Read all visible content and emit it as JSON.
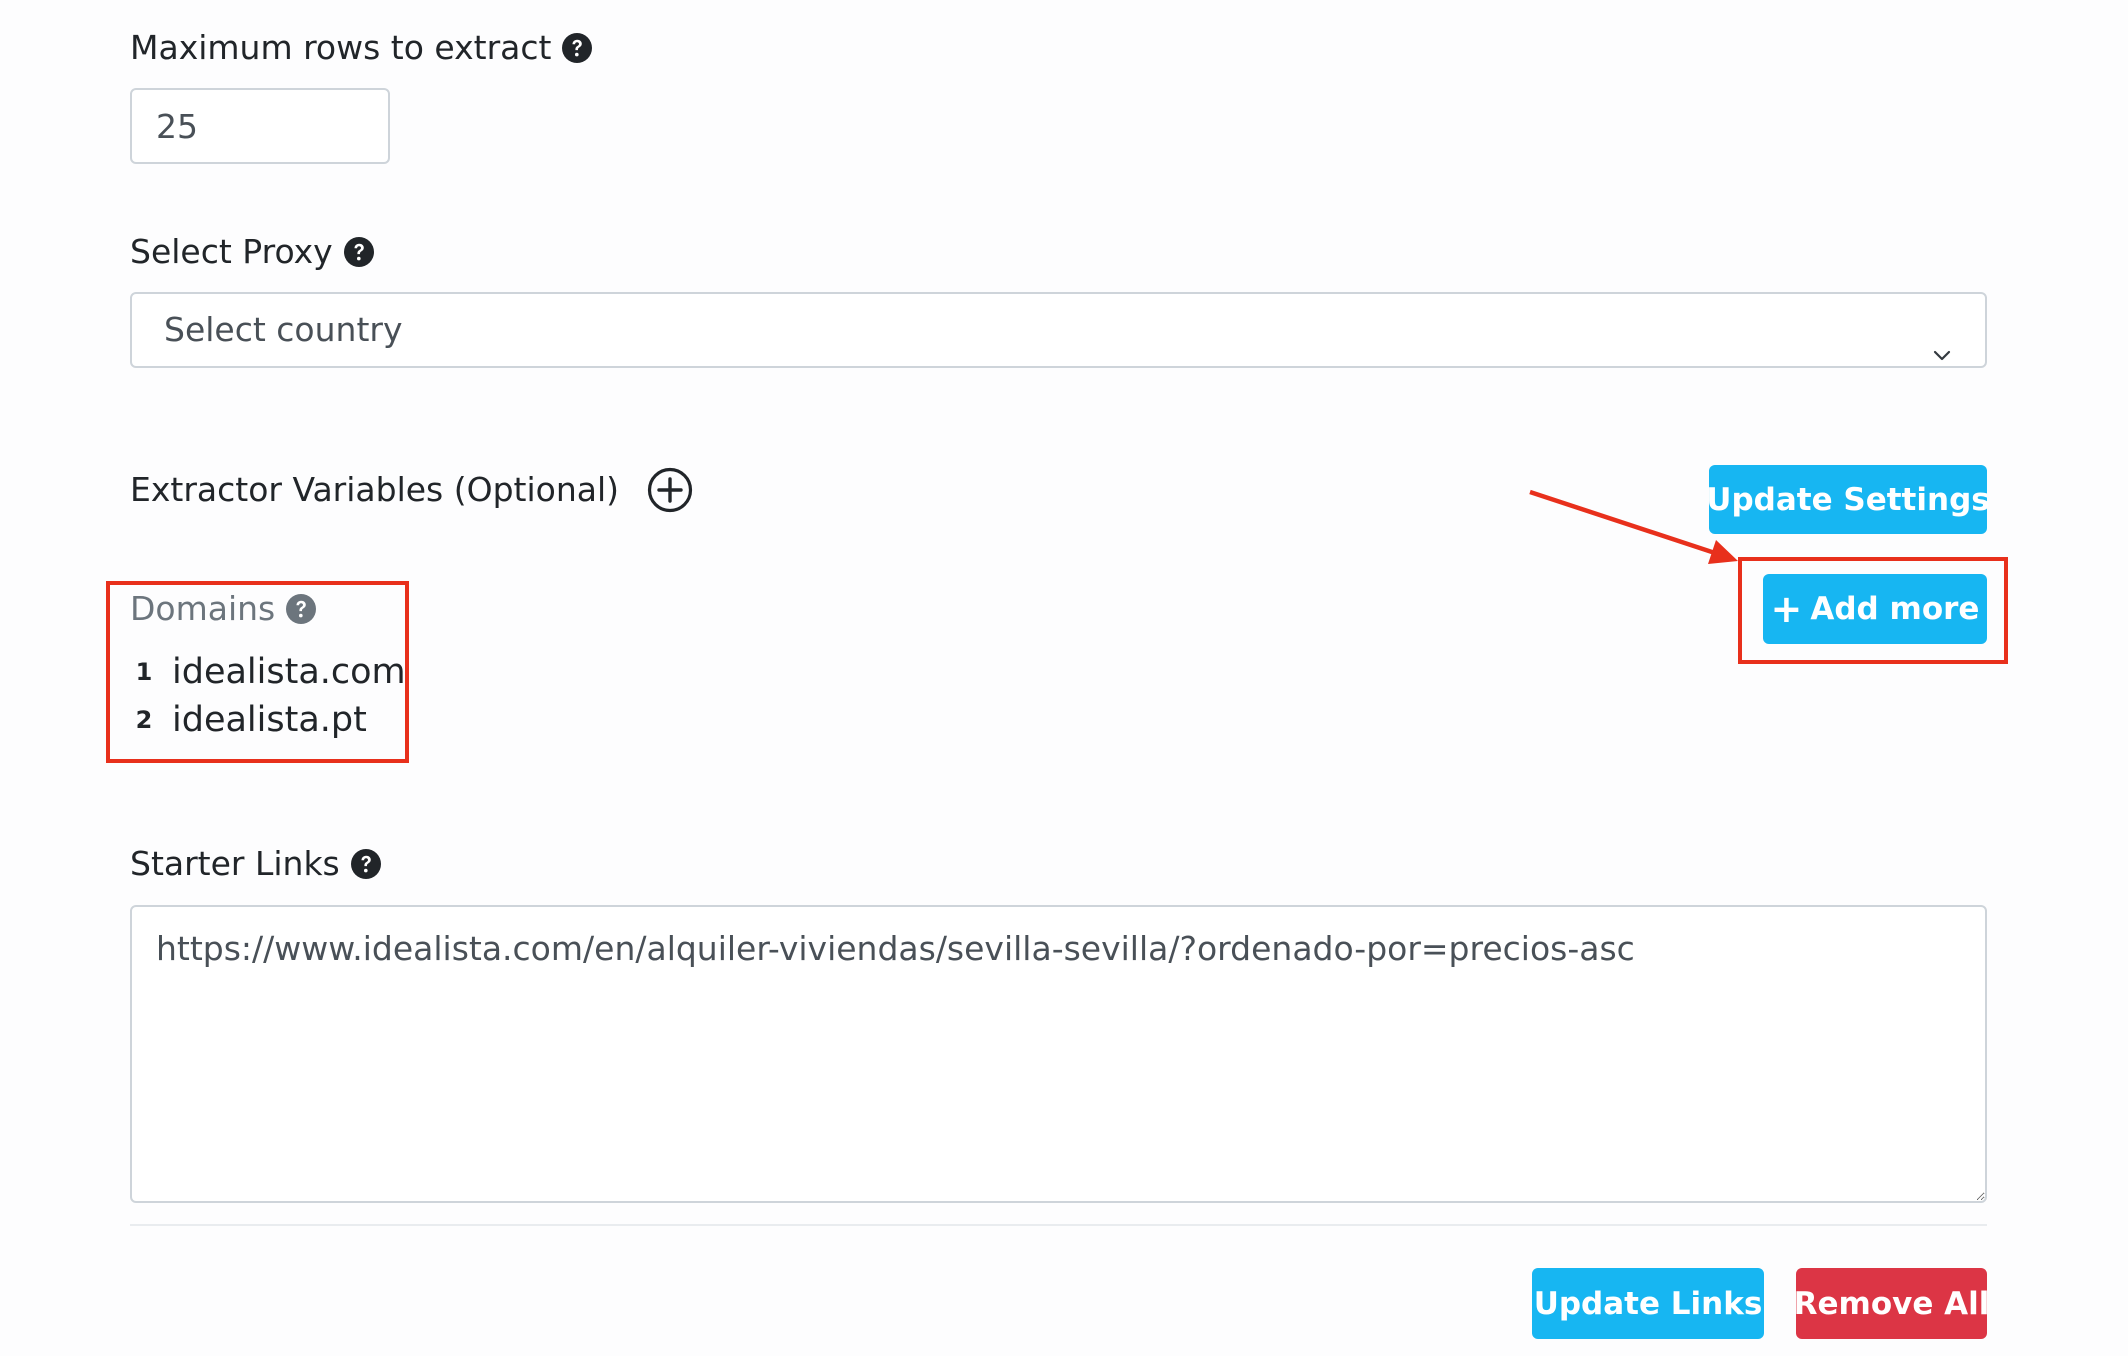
{
  "max_rows": {
    "label": "Maximum rows to extract",
    "value": "25"
  },
  "proxy": {
    "label": "Select Proxy",
    "selected": "Select country"
  },
  "extractor_variables": {
    "label": "Extractor Variables (Optional)"
  },
  "buttons": {
    "update_settings": "Update Settings",
    "add_more": "Add more",
    "update_links": "Update Links",
    "remove_all": "Remove All"
  },
  "domains": {
    "label": "Domains",
    "items": [
      {
        "num": "1",
        "name": "idealista.com"
      },
      {
        "num": "2",
        "name": "idealista.pt"
      }
    ]
  },
  "starter_links": {
    "label": "Starter Links",
    "value": "https://www.idealista.com/en/alquiler-viviendas/sevilla-sevilla/?ordenado-por=precios-asc"
  },
  "colors": {
    "accent": "#17b6f2",
    "danger": "#dc3545",
    "annotation": "#e8301c"
  },
  "icons": {
    "help": "question-circle-icon",
    "add_variable": "plus-circle-icon",
    "dropdown": "chevron-down-icon",
    "annotation_arrow": "arrow-icon"
  }
}
